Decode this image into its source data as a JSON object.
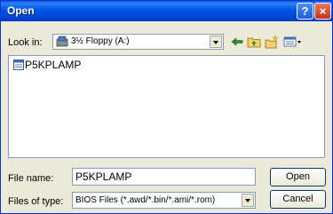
{
  "window": {
    "title": "Open",
    "help_label": "?",
    "close_label": "×"
  },
  "look_in": {
    "label": "Look in:",
    "value": "3½ Floppy (A:)",
    "icon": "floppy-drive-icon"
  },
  "toolbar": {
    "icons": [
      "back-arrow-icon",
      "up-folder-icon",
      "new-folder-icon",
      "views-menu-icon"
    ]
  },
  "files": [
    {
      "name": "P5KPLAMP",
      "icon": "file-icon"
    }
  ],
  "file_name": {
    "label": "File name:",
    "value": "P5KPLAMP"
  },
  "file_type": {
    "label": "Files of type:",
    "value": "BIOS Files (*.awd/*.bin/*.ami/*.rom)"
  },
  "buttons": {
    "open": "Open",
    "cancel": "Cancel"
  },
  "colors": {
    "titlebar": "#0055e5",
    "dialog_bg": "#ece9d8",
    "field_border": "#7f9db9"
  }
}
